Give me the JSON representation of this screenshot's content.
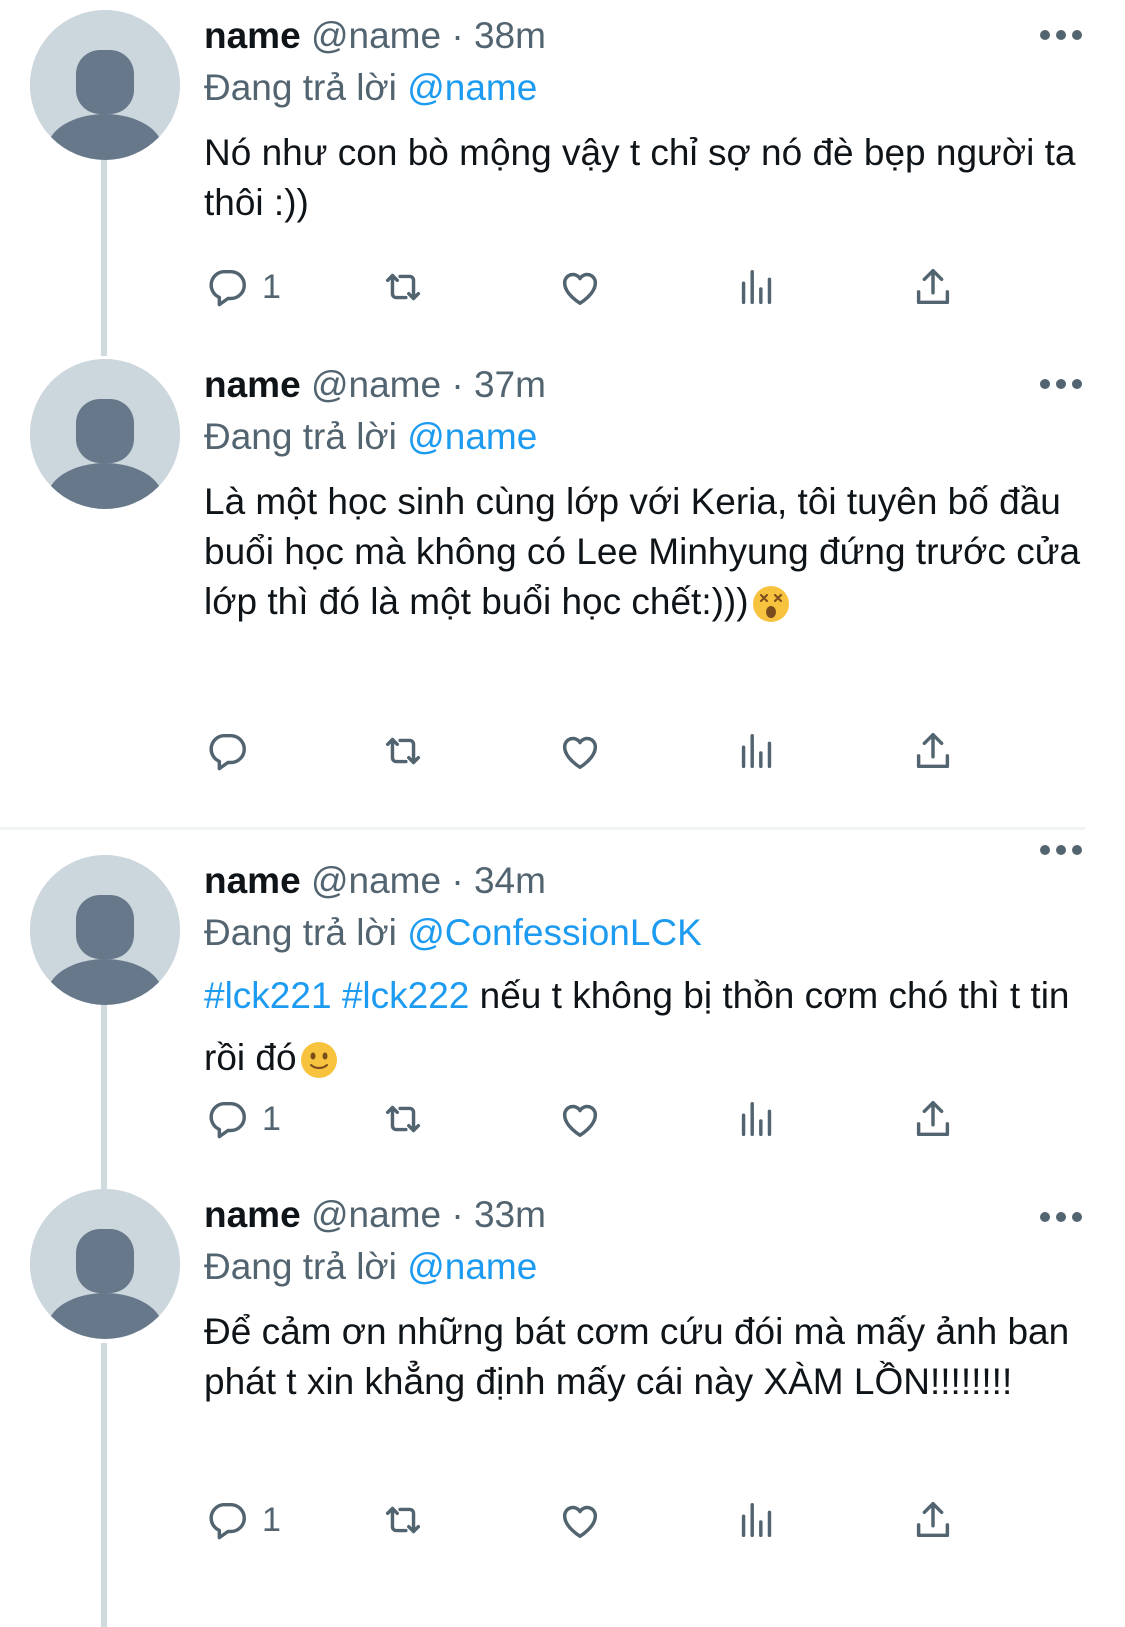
{
  "tweets": [
    {
      "name": "name",
      "handle": "@name",
      "dot": "·",
      "time": "38m",
      "reply_prefix": "Đang trả lời",
      "reply_to": "@name",
      "text": "Nó như con bò mộng vậy t chỉ sợ nó đè bẹp người ta thôi :))",
      "reply_count": "1"
    },
    {
      "name": "name",
      "handle": "@name",
      "dot": "·",
      "time": "37m",
      "reply_prefix": "Đang trả lời",
      "reply_to": "@name",
      "text": "Là một học sinh cùng lớp với Keria, tôi tuyên bố đầu buổi học mà không có Lee Minhyung đứng trước cửa lớp thì đó là một buổi học chết:)))",
      "emoji": "dizzy-face-emoji",
      "reply_count": ""
    },
    {
      "name": "name",
      "handle": "@name",
      "dot": "·",
      "time": "34m",
      "reply_prefix": "Đang trả lời",
      "reply_to": "@ConfessionLCK",
      "hashtags": [
        "#lck221",
        "#lck222"
      ],
      "text": "nếu t không bị thồn cơm chó thì t tin rồi đó",
      "emoji": "slight-smile-emoji",
      "reply_count": "1"
    },
    {
      "name": "name",
      "handle": "@name",
      "dot": "·",
      "time": "33m",
      "reply_prefix": "Đang trả lời",
      "reply_to": "@name",
      "text": "Để cảm ơn những bát cơm cứu đói mà mấy ảnh ban phát t xin khẳng định mấy cái này XÀM LỒN!!!!!!!!",
      "reply_count": "1"
    }
  ],
  "colors": {
    "link": "#1d9bf0",
    "secondary_text": "#536471",
    "primary_text": "#0f1419",
    "avatar_bg": "#ccd6dd",
    "avatar_fg": "#66788a",
    "thread_line": "#cfd9de"
  },
  "icons": [
    "reply-icon",
    "retweet-icon",
    "like-icon",
    "views-icon",
    "share-icon",
    "more-icon"
  ]
}
